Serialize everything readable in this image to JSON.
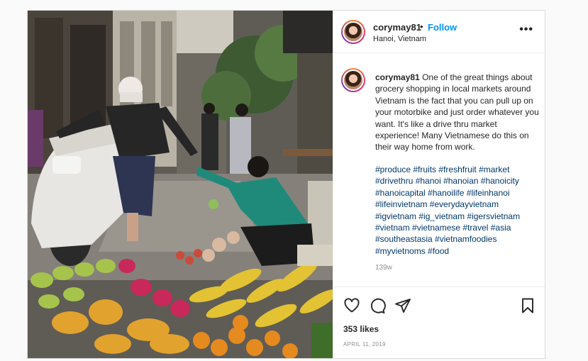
{
  "post": {
    "username": "corymay81",
    "separator": "•",
    "follow_label": "Follow",
    "location": "Hanoi, Vietnam",
    "more_icon": "more-horizontal-icon",
    "caption_text": "One of the great things about grocery shopping in local markets around Vietnam is the fact that you can pull up on your motorbike and just order whatever you want. It's like a drive thru market experience! Many Vietnamese do this on their way home from work.",
    "hashtags": "#produce #fruits #freshfruit #market #drivethru #hanoi #hanoian #hanoicity #hanoicapital #hanoilife #lifeinhanoi #lifeinvietnam #everydayvietnam #igvietnam #ig_vietnam #igersvietnam #vietnam #vietnamese #travel #asia #southeastasia #vietnamfoodies #myvietnoms #food",
    "time_ago": "139w",
    "likes": "353 likes",
    "date": "APRIL 11, 2019"
  },
  "actions": {
    "like_icon": "heart-icon",
    "comment_icon": "comment-icon",
    "share_icon": "share-icon",
    "save_icon": "bookmark-icon"
  },
  "colors": {
    "link_blue": "#0095f6",
    "hashtag_blue": "#00376b",
    "meta_gray": "#8e8e8e",
    "border": "#dbdbdb"
  }
}
